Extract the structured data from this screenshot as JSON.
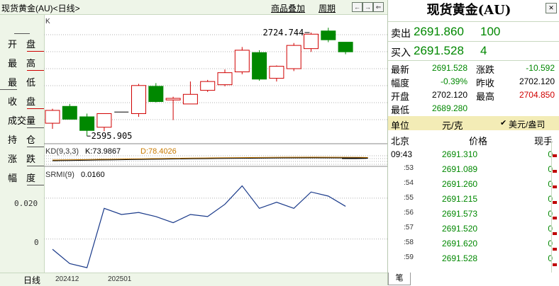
{
  "toolbar": {
    "title": "现货黄金(AU)<日线>",
    "overlay_label": "商品叠加",
    "period_label": "周期",
    "nav_buttons": [
      "←",
      "→",
      "⇐",
      "⇒"
    ]
  },
  "left_menu": [
    {
      "a": "开",
      "b": "盘"
    },
    {
      "a": "最",
      "b": "高"
    },
    {
      "a": "最",
      "b": "低"
    },
    {
      "a": "收",
      "b": "盘"
    },
    {
      "a": "成交",
      "b": "量"
    },
    {
      "a": "持",
      "b": "仓"
    },
    {
      "a": "涨",
      "b": "跌"
    },
    {
      "a": "幅",
      "b": "度"
    }
  ],
  "bottom_period": "日线",
  "dates": [
    "202412",
    "202501"
  ],
  "main_chart": {
    "label": "K",
    "high_annotation": "2724.744",
    "low_annotation": "2595.905"
  },
  "kd": {
    "label": "KD(9,3,3)",
    "k_label": "K:73.9867",
    "d_label": "D:78.4026"
  },
  "srmi": {
    "label": "SRMI(9)",
    "value": "0.0160",
    "y_ticks": [
      "0.020",
      "0"
    ]
  },
  "chart_data": {
    "type": "candlestick",
    "candles": [
      {
        "open": 2612,
        "high": 2630,
        "low": 2605,
        "close": 2628
      },
      {
        "open": 2633,
        "high": 2636,
        "low": 2617,
        "close": 2617
      },
      {
        "open": 2620,
        "high": 2624,
        "low": 2596,
        "close": 2603
      },
      {
        "open": 2607,
        "high": 2624,
        "low": 2602,
        "close": 2624
      },
      {
        "open": 2626,
        "high": 2626,
        "low": 2626,
        "close": 2626
      },
      {
        "open": 2624,
        "high": 2661,
        "low": 2620,
        "close": 2659
      },
      {
        "open": 2658,
        "high": 2662,
        "low": 2638,
        "close": 2639
      },
      {
        "open": 2641,
        "high": 2645,
        "low": 2616,
        "close": 2643
      },
      {
        "open": 2636,
        "high": 2664,
        "low": 2636,
        "close": 2648
      },
      {
        "open": 2653,
        "high": 2666,
        "low": 2651,
        "close": 2664
      },
      {
        "open": 2660,
        "high": 2679,
        "low": 2658,
        "close": 2675
      },
      {
        "open": 2676,
        "high": 2707,
        "low": 2673,
        "close": 2703
      },
      {
        "open": 2700,
        "high": 2703,
        "low": 2665,
        "close": 2667
      },
      {
        "open": 2668,
        "high": 2684,
        "low": 2664,
        "close": 2683
      },
      {
        "open": 2680,
        "high": 2712,
        "low": 2677,
        "close": 2709
      },
      {
        "open": 2705,
        "high": 2725,
        "low": 2701,
        "close": 2723
      },
      {
        "open": 2727,
        "high": 2731,
        "low": 2713,
        "close": 2716
      },
      {
        "open": 2713,
        "high": 2713,
        "low": 2698,
        "close": 2701
      }
    ],
    "srmi_values": [
      -0.005,
      -0.012,
      -0.014,
      0.015,
      0.012,
      0.013,
      0.011,
      0.008,
      0.012,
      0.011,
      0.017,
      0.026,
      0.015,
      0.018,
      0.015,
      0.023,
      0.021,
      0.016
    ],
    "price_range": [
      2590,
      2740
    ],
    "srmi_range": [
      -0.015,
      0.03
    ]
  },
  "panel": {
    "title": "现货黄金(AU)",
    "sell_label": "卖出",
    "sell_price": "2691.860",
    "sell_qty": "100",
    "buy_label": "买入",
    "buy_price": "2691.528",
    "buy_qty": "4",
    "stats": [
      {
        "label": "最新",
        "value": "2691.528",
        "color": "#008800"
      },
      {
        "label": "涨跌",
        "value": "-10.592",
        "color": "#008800"
      },
      {
        "label": "幅度",
        "value": "-0.39%",
        "color": "#008800"
      },
      {
        "label": "昨收",
        "value": "2702.120",
        "color": "#000000"
      },
      {
        "label": "开盘",
        "value": "2702.120",
        "color": "#000000"
      },
      {
        "label": "最高",
        "value": "2704.850",
        "color": "#d00000"
      },
      {
        "label": "最低",
        "value": "2689.280",
        "color": "#008800"
      }
    ],
    "unit_label": "单位",
    "unit_value": "元/克",
    "alt_unit": "美元/盎司",
    "tick_headers": [
      "北京",
      "价格",
      "现手"
    ],
    "ticks": [
      {
        "time": "09:43",
        "price": "2691.310",
        "qty": "0"
      },
      {
        "time": ":53",
        "price": "2691.089",
        "qty": "0"
      },
      {
        "time": ":54",
        "price": "2691.260",
        "qty": "0"
      },
      {
        "time": ":55",
        "price": "2691.215",
        "qty": "0"
      },
      {
        "time": ":56",
        "price": "2691.573",
        "qty": "0"
      },
      {
        "time": ":57",
        "price": "2691.520",
        "qty": "0"
      },
      {
        "time": ":58",
        "price": "2691.620",
        "qty": "0"
      },
      {
        "time": ":59",
        "price": "2691.528",
        "qty": "0"
      }
    ],
    "pen_tab": "笔"
  },
  "colors": {
    "up": "#d00000",
    "down": "#008800",
    "accent_bg": "#eef5e8"
  }
}
